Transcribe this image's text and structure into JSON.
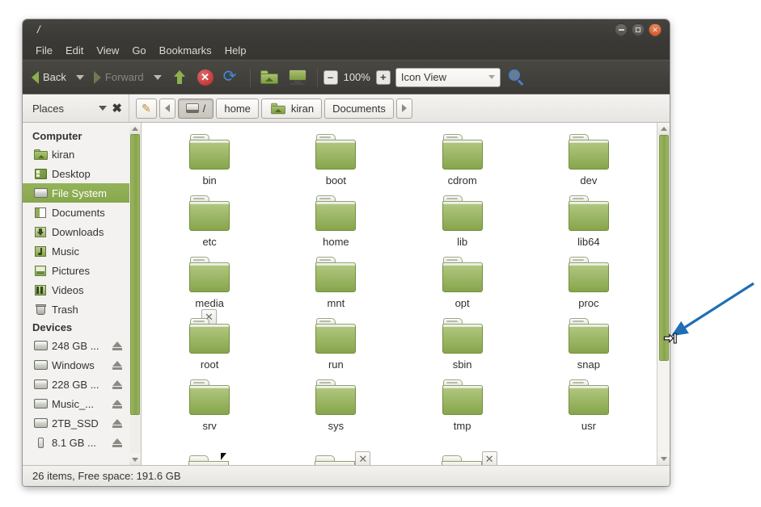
{
  "window": {
    "title": "/",
    "controls": {
      "minimize": "–",
      "maximize": "□",
      "close": "✕"
    }
  },
  "menubar": {
    "items": [
      {
        "label": "File"
      },
      {
        "label": "Edit"
      },
      {
        "label": "View"
      },
      {
        "label": "Go"
      },
      {
        "label": "Bookmarks"
      },
      {
        "label": "Help"
      }
    ]
  },
  "toolbar": {
    "back_label": "Back",
    "forward_label": "Forward",
    "zoom_out": "–",
    "zoom_level": "100%",
    "zoom_in": "+",
    "view_mode": "Icon View",
    "icons": {
      "back": "chevron-left-icon",
      "forward": "chevron-right-icon",
      "up": "up-arrow-icon",
      "stop": "stop-icon",
      "reload": "reload-icon",
      "home_folder": "home-folder-icon",
      "desktop": "desktop-icon",
      "search": "search-icon"
    }
  },
  "pathbar": {
    "places_label": "Places",
    "close_label": "✖",
    "edit_path_icon": "pencil-icon",
    "crumbs": [
      {
        "label": "/",
        "icon": "drive-icon",
        "active": true
      },
      {
        "label": "home",
        "icon": "",
        "active": false
      },
      {
        "label": "kiran",
        "icon": "home-folder-icon",
        "active": false
      },
      {
        "label": "Documents",
        "icon": "",
        "active": false
      }
    ]
  },
  "sidebar": {
    "sections": [
      {
        "title": "Computer",
        "items": [
          {
            "label": "kiran",
            "icon": "home-folder-icon",
            "selected": false,
            "eject": false
          },
          {
            "label": "Desktop",
            "icon": "desktop-icon",
            "selected": false,
            "eject": false
          },
          {
            "label": "File System",
            "icon": "disk-icon",
            "selected": true,
            "eject": false
          },
          {
            "label": "Documents",
            "icon": "documents-icon",
            "selected": false,
            "eject": false
          },
          {
            "label": "Downloads",
            "icon": "downloads-icon",
            "selected": false,
            "eject": false
          },
          {
            "label": "Music",
            "icon": "music-icon",
            "selected": false,
            "eject": false
          },
          {
            "label": "Pictures",
            "icon": "pictures-icon",
            "selected": false,
            "eject": false
          },
          {
            "label": "Videos",
            "icon": "videos-icon",
            "selected": false,
            "eject": false
          },
          {
            "label": "Trash",
            "icon": "trash-icon",
            "selected": false,
            "eject": false
          }
        ]
      },
      {
        "title": "Devices",
        "items": [
          {
            "label": "248 GB ...",
            "icon": "disk-icon",
            "selected": false,
            "eject": true
          },
          {
            "label": "Windows",
            "icon": "disk-icon",
            "selected": false,
            "eject": true
          },
          {
            "label": "228 GB ...",
            "icon": "disk-icon",
            "selected": false,
            "eject": true
          },
          {
            "label": "Music_...",
            "icon": "disk-icon",
            "selected": false,
            "eject": true
          },
          {
            "label": "2TB_SSD",
            "icon": "disk-icon",
            "selected": false,
            "eject": true
          },
          {
            "label": "8.1 GB ...",
            "icon": "usb-icon",
            "selected": false,
            "eject": true
          }
        ]
      }
    ]
  },
  "iconview": {
    "folders": [
      {
        "name": "bin"
      },
      {
        "name": "boot"
      },
      {
        "name": "cdrom"
      },
      {
        "name": "dev"
      },
      {
        "name": "etc"
      },
      {
        "name": "home"
      },
      {
        "name": "lib"
      },
      {
        "name": "lib64"
      },
      {
        "name": "media"
      },
      {
        "name": "mnt"
      },
      {
        "name": "opt"
      },
      {
        "name": "proc"
      },
      {
        "name": "root"
      },
      {
        "name": "run"
      },
      {
        "name": "sbin"
      },
      {
        "name": "snap"
      },
      {
        "name": "srv"
      },
      {
        "name": "sys"
      },
      {
        "name": "tmp"
      },
      {
        "name": "usr"
      }
    ],
    "overlay_close_label": "✕"
  },
  "statusbar": {
    "text": "26 items, Free space: 191.6 GB"
  },
  "annotation": {
    "arrow_color": "#1f6fb5",
    "cursor_type": "horizontal-resize-cursor"
  },
  "colors": {
    "titlebar": "#3b3935",
    "toolbar": "#433f3b",
    "selection_green": "#8aa850",
    "scrollbar_green": "#87a44c",
    "folder_green": "#9fb96a"
  }
}
